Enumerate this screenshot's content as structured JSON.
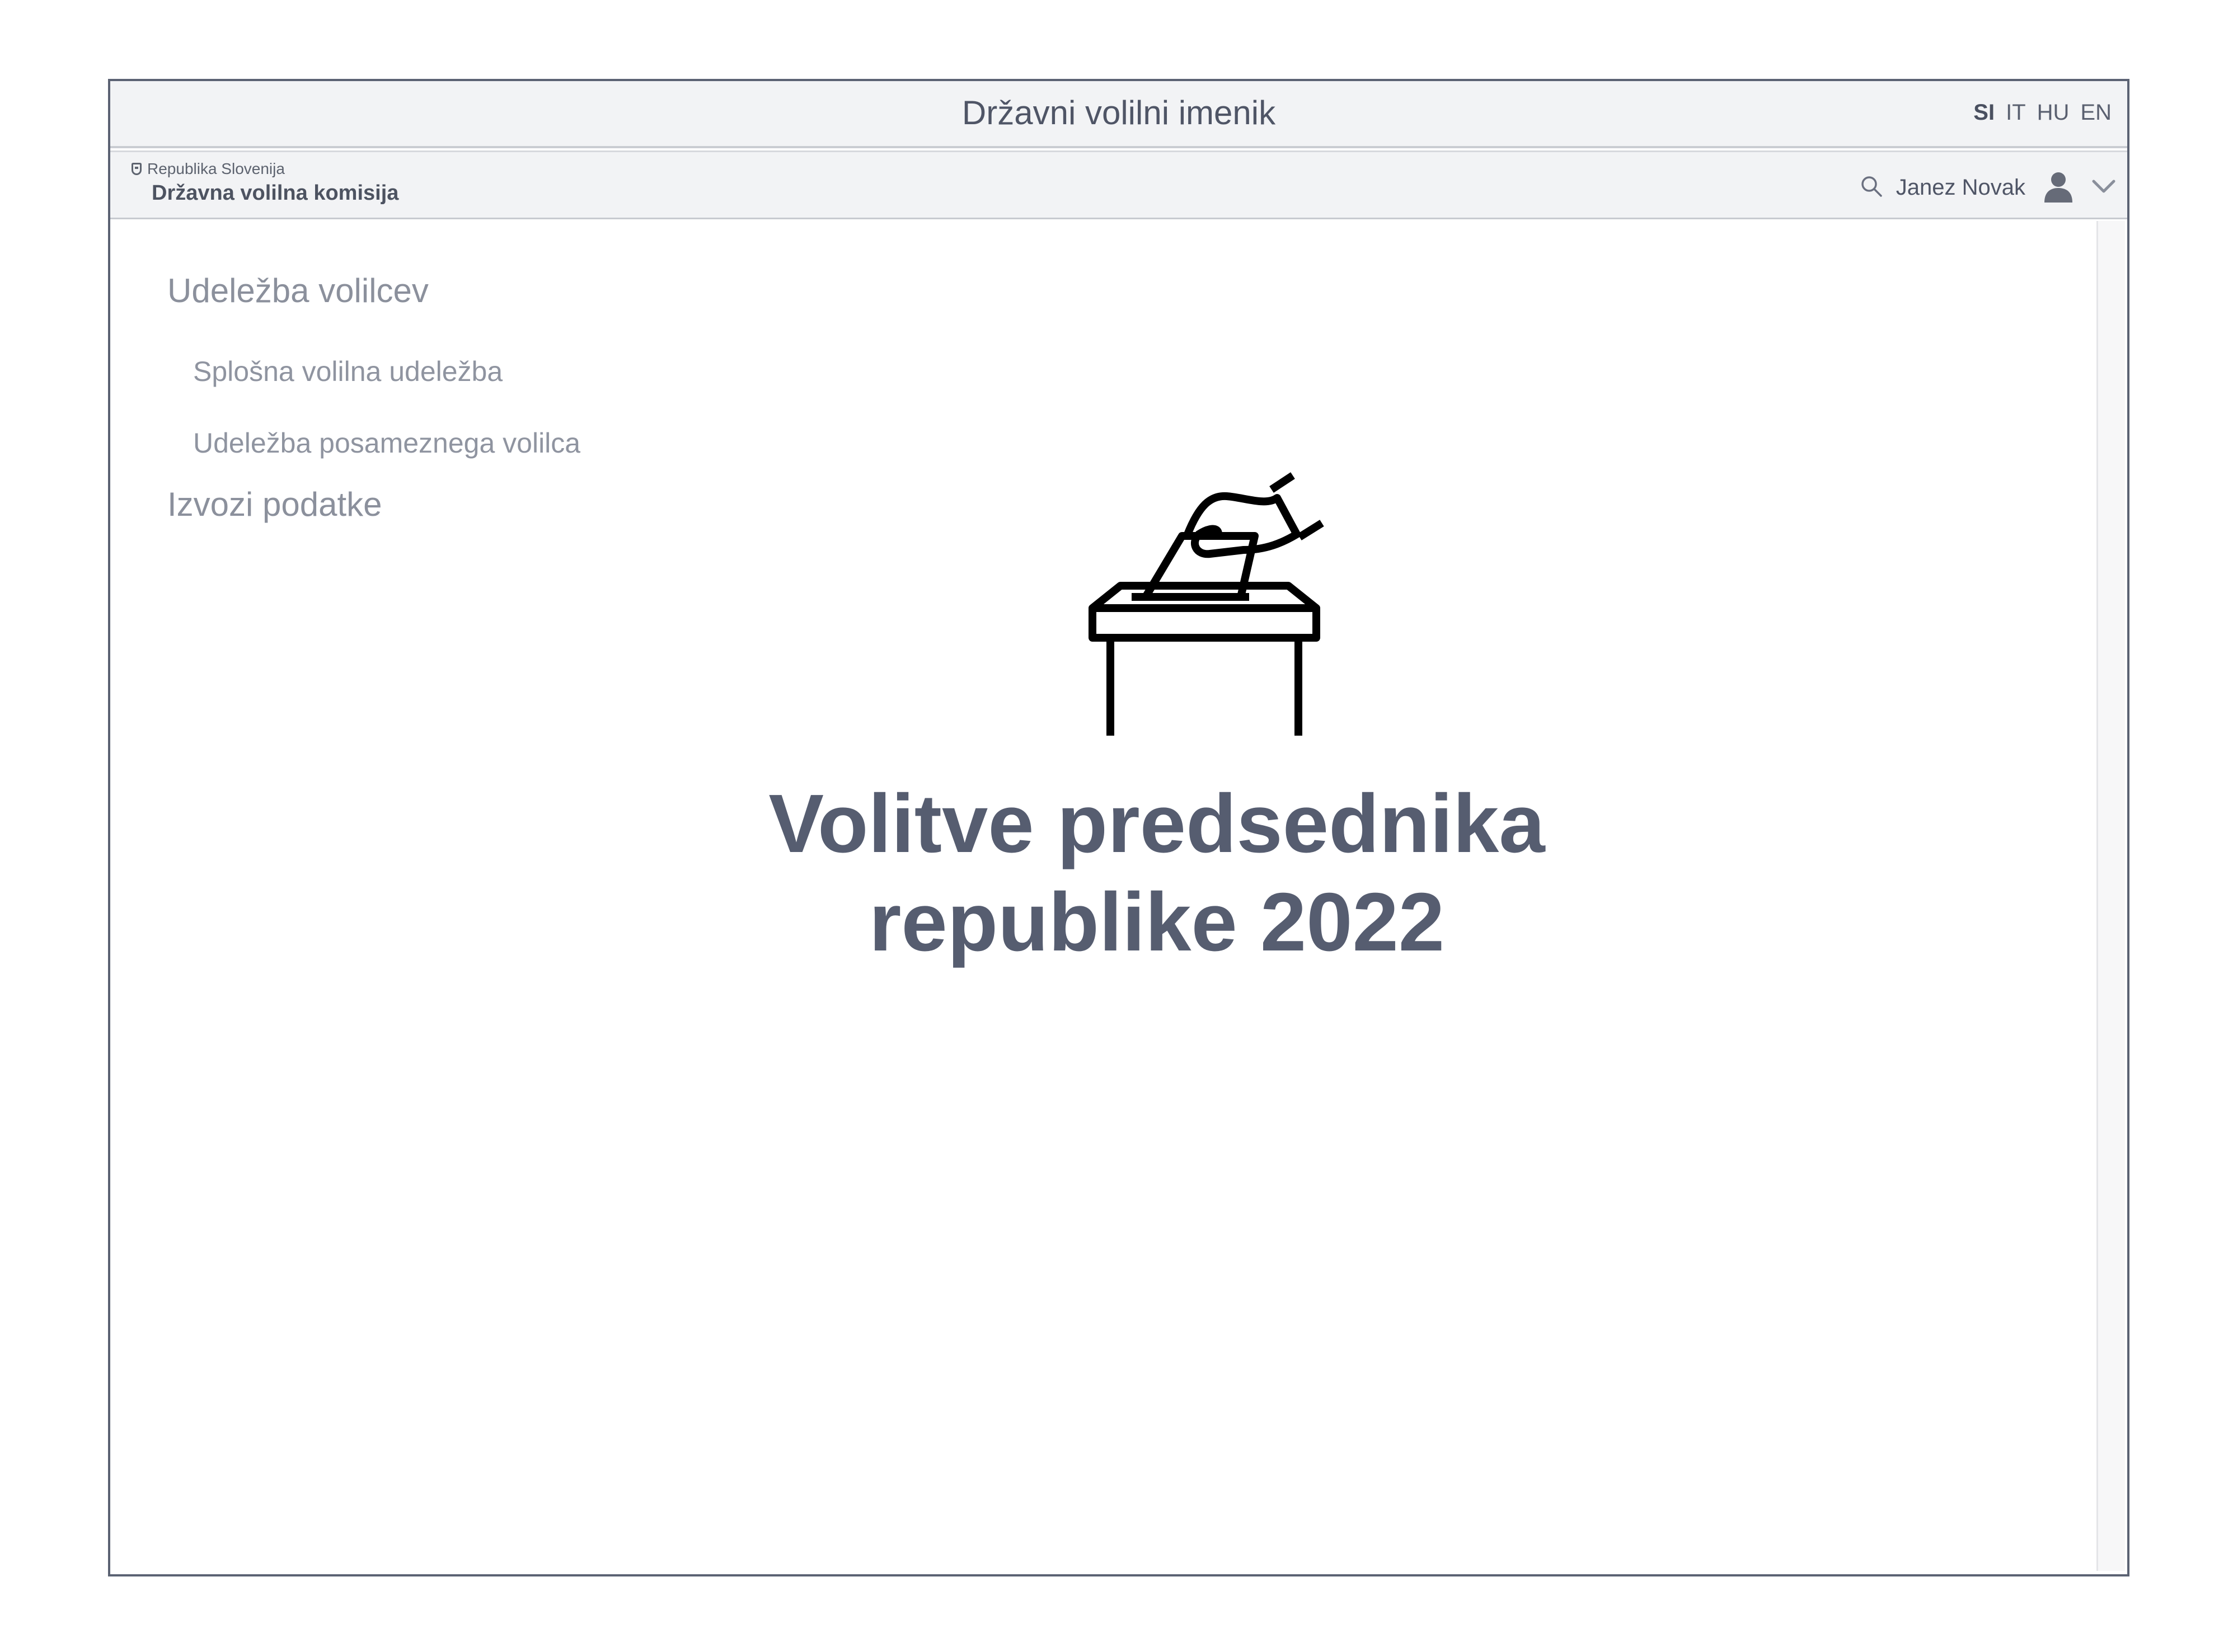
{
  "app": {
    "title": "Državni volilni imenik"
  },
  "languages": [
    {
      "code": "SI",
      "active": true
    },
    {
      "code": "IT",
      "active": false
    },
    {
      "code": "HU",
      "active": false
    },
    {
      "code": "EN",
      "active": false
    }
  ],
  "header": {
    "org_small": "Republika Slovenija",
    "org_name": "Državna volilna komisija",
    "user_name": "Janez Novak",
    "icons": [
      "search-icon",
      "user-icon",
      "chevron-down-icon"
    ]
  },
  "sidebar": {
    "items": [
      {
        "label": "Udeležba volilcev",
        "level": 1
      },
      {
        "label": "Splošna volilna udeležba",
        "level": 2
      },
      {
        "label": "Udeležba posameznega volilca",
        "level": 2
      },
      {
        "label": "Izvozi podatke",
        "level": 1
      }
    ]
  },
  "main": {
    "icon": "ballot-box-icon",
    "title_line1": "Volitve predsednika",
    "title_line2": "republike 2022"
  },
  "colors": {
    "text_primary": "#565d70",
    "nav_text": "#8b909c",
    "bar_background": "#f2f3f5",
    "border": "#5b6273"
  }
}
